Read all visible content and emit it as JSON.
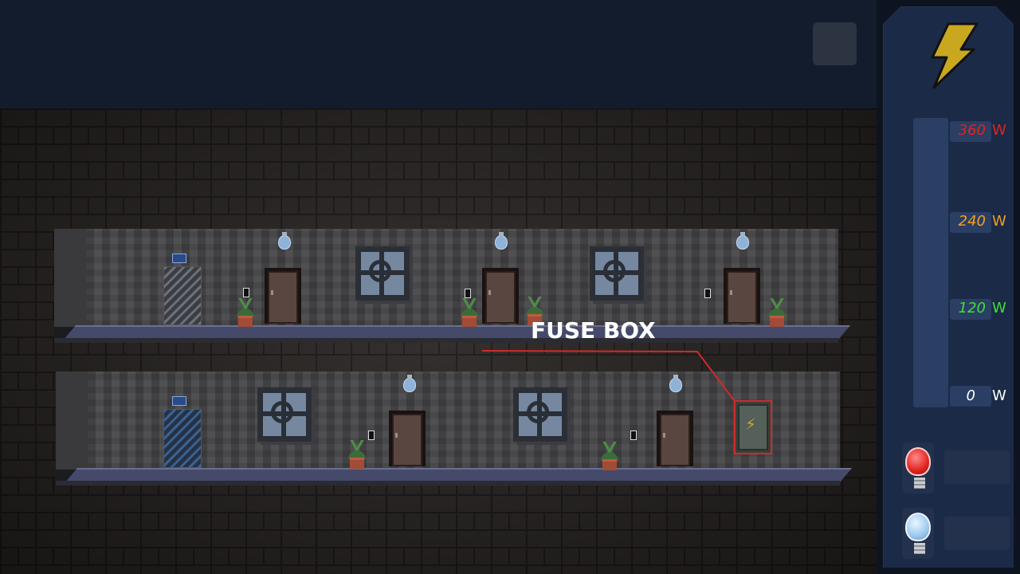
{
  "scene": {
    "fuse_box_label": "FUSE BOX",
    "floors": [
      {
        "name": "upper-floor"
      },
      {
        "name": "lower-floor"
      }
    ]
  },
  "power_panel": {
    "scale": [
      {
        "value": "360",
        "unit": "W",
        "color": "#e0241f"
      },
      {
        "value": "240",
        "unit": "W",
        "color": "#f0a020"
      },
      {
        "value": "120",
        "unit": "W",
        "color": "#3ee03a"
      },
      {
        "value": "0",
        "unit": "W",
        "color": "#ffffff"
      }
    ],
    "current_usage_fraction": 0,
    "bulbs": [
      {
        "icon": "red-bulb-icon",
        "value": ""
      },
      {
        "icon": "blue-bulb-icon",
        "value": ""
      }
    ]
  },
  "colors": {
    "accent_bolt": "#c9a820",
    "highlight_red": "#d02a2a",
    "panel_bg": "#1b2a47"
  }
}
